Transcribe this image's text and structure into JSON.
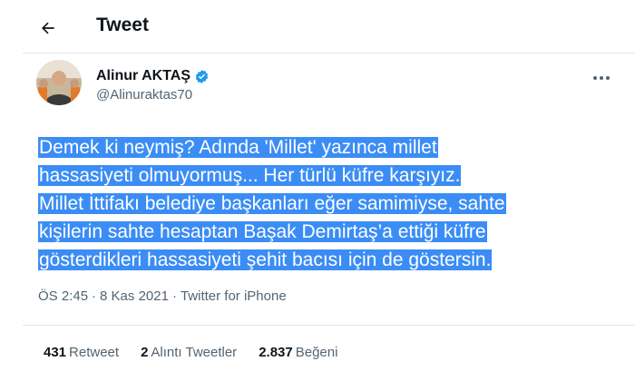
{
  "header": {
    "title": "Tweet",
    "back_icon": "arrow-left-icon"
  },
  "author": {
    "display_name": "Alinur AKTAŞ",
    "handle": "@Alinuraktas70",
    "verified_icon": "verified-badge-icon",
    "verified_color": "#1d9bf0"
  },
  "tweet": {
    "lines": [
      "Demek ki neymiş? Adında 'Millet' yazınca millet",
      "hassasiyeti olmuyormuş... Her türlü küfre karşıyız.",
      "Millet İttifakı belediye başkanları eğer samimiyse, sahte",
      "kişilerin sahte hesaptan Başak Demirtaş’a ettiği küfre",
      "gösterdikleri hassasiyeti şehit bacısı için de göstersin."
    ],
    "highlight_color": "#3b8df5"
  },
  "meta": {
    "time": "ÖS 2:45",
    "separator": "·",
    "date": "8 Kas 2021",
    "source": "Twitter for iPhone"
  },
  "stats": {
    "retweets": {
      "count": "431",
      "label": "Retweet"
    },
    "quotes": {
      "count": "2",
      "label": "Alıntı Tweetler"
    },
    "likes": {
      "count": "2.837",
      "label": "Beğeni"
    }
  }
}
